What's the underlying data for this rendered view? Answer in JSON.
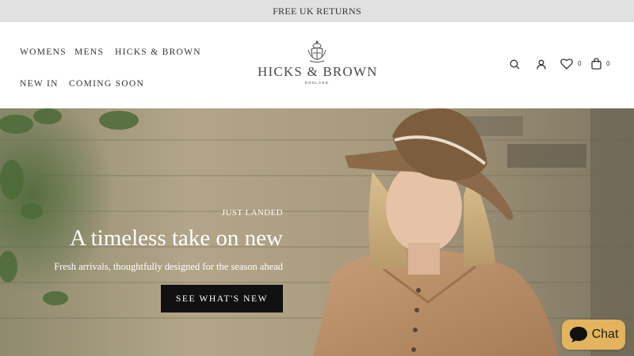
{
  "announcement": {
    "text": "FREE UK RETURNS"
  },
  "nav": {
    "items": [
      {
        "label": "WOMENS"
      },
      {
        "label": "MENS"
      },
      {
        "label": "HICKS & BROWN"
      },
      {
        "label": "NEW IN"
      },
      {
        "label": "COMING SOON"
      }
    ]
  },
  "logo": {
    "name": "HICKS & BROWN",
    "sub": "ENGLAND"
  },
  "header_icons": {
    "search": "search-icon",
    "account": "user-icon",
    "wishlist": "heart-icon",
    "wishlist_count": "0",
    "cart": "bag-icon",
    "cart_count": "0"
  },
  "hero": {
    "kicker": "JUST LANDED",
    "headline": "A timeless take on new",
    "subhead": "Fresh arrivals, thoughtfully designed for the season ahead",
    "cta_label": "SEE WHAT'S NEW"
  },
  "chat": {
    "label": "Chat"
  },
  "colors": {
    "announcement_bg": "#e1e1e1",
    "cta_bg": "#111111",
    "chat_bg": "#e3b45d"
  }
}
